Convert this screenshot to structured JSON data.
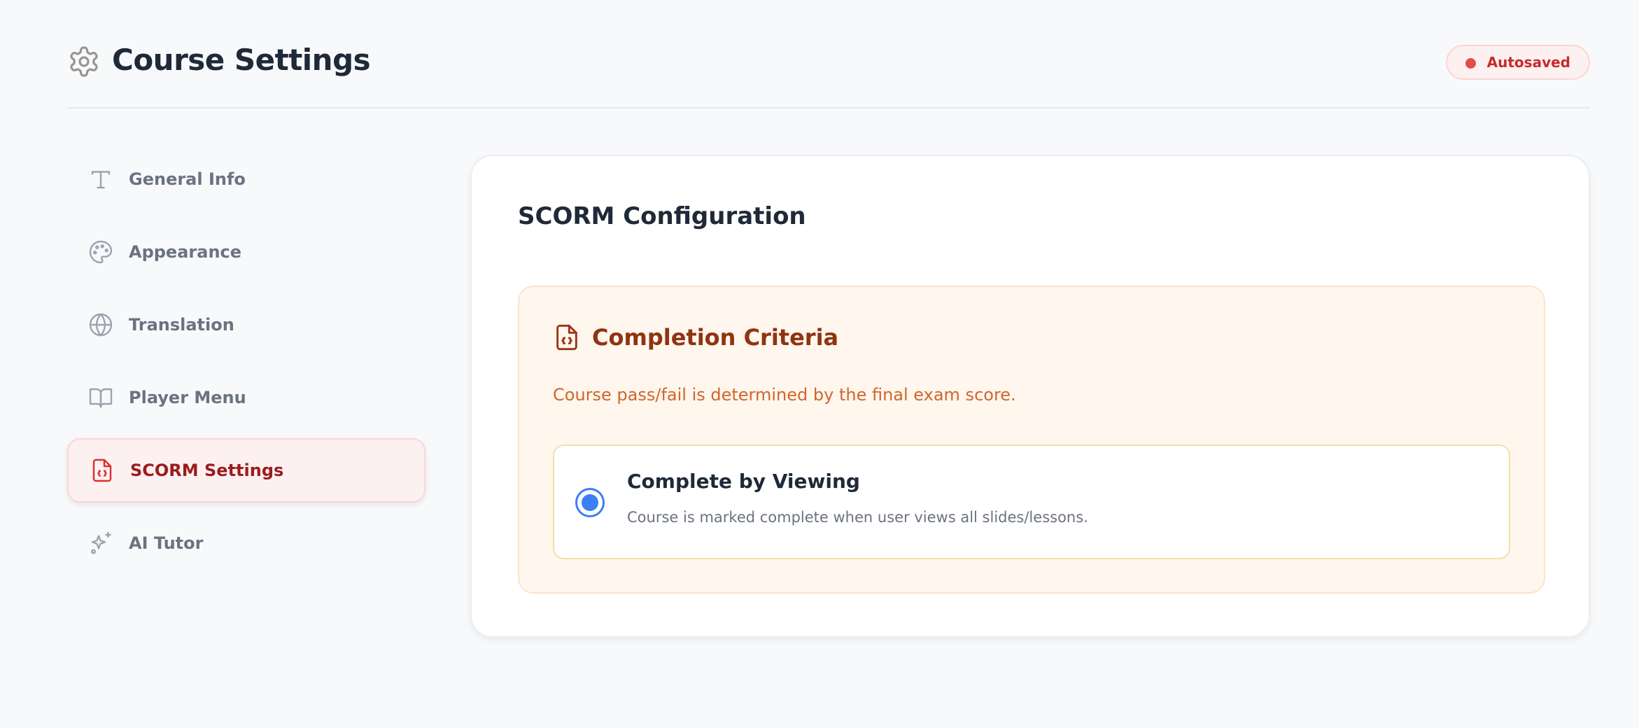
{
  "header": {
    "title": "Course Settings",
    "title_icon": "gear-icon",
    "status_badge": "Autosaved",
    "status_color": "#e24c4b"
  },
  "sidebar": {
    "items": [
      {
        "label": "General Info",
        "icon": "text-icon",
        "active": false
      },
      {
        "label": "Appearance",
        "icon": "palette-icon",
        "active": false
      },
      {
        "label": "Translation",
        "icon": "globe-icon",
        "active": false
      },
      {
        "label": "Player Menu",
        "icon": "book-icon",
        "active": false
      },
      {
        "label": "SCORM Settings",
        "icon": "file-code-icon",
        "active": true
      },
      {
        "label": "AI Tutor",
        "icon": "sparkles-icon",
        "active": false
      }
    ]
  },
  "main": {
    "section_title": "SCORM Configuration",
    "panel": {
      "title": "Completion Criteria",
      "icon": "file-code-icon",
      "description": "Course pass/fail is determined by the final exam score.",
      "option": {
        "title": "Complete by Viewing",
        "description": "Course is marked complete when user views all slides/lessons.",
        "selected": true
      }
    }
  },
  "colors": {
    "accent": "#dc2f2f",
    "radio": "#3b7ff5",
    "panel_bg": "#fff6ed",
    "panel_title": "#8f3412"
  }
}
